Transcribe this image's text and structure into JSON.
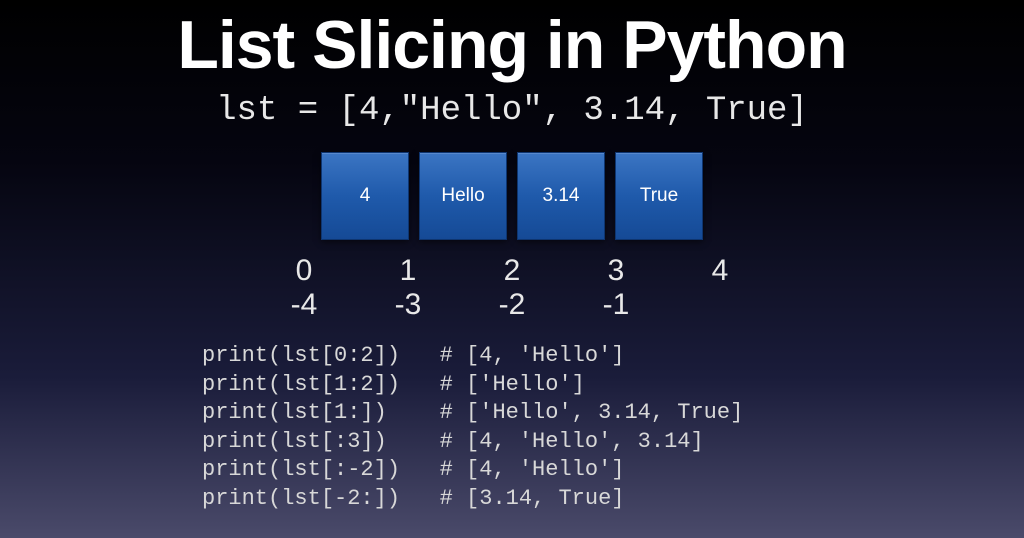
{
  "title": "List Slicing in Python",
  "declaration": "lst = [4,\"Hello\", 3.14, True]",
  "boxes": [
    "4",
    "Hello",
    "3.14",
    "True"
  ],
  "pos_indices": [
    "0",
    "1",
    "2",
    "3",
    "4"
  ],
  "neg_indices": [
    "-4",
    "-3",
    "-2",
    "-1"
  ],
  "code_lines": [
    {
      "stmt": "print(lst[0:2])",
      "pad": "   ",
      "comment": "# [4, 'Hello']"
    },
    {
      "stmt": "print(lst[1:2])",
      "pad": "   ",
      "comment": "# ['Hello']"
    },
    {
      "stmt": "print(lst[1:])",
      "pad": "    ",
      "comment": "# ['Hello', 3.14, True]"
    },
    {
      "stmt": "print(lst[:3])",
      "pad": "    ",
      "comment": "# [4, 'Hello', 3.14]"
    },
    {
      "stmt": "print(lst[:-2])",
      "pad": "   ",
      "comment": "# [4, 'Hello']"
    },
    {
      "stmt": "print(lst[-2:])",
      "pad": "   ",
      "comment": "# [3.14, True]"
    }
  ]
}
